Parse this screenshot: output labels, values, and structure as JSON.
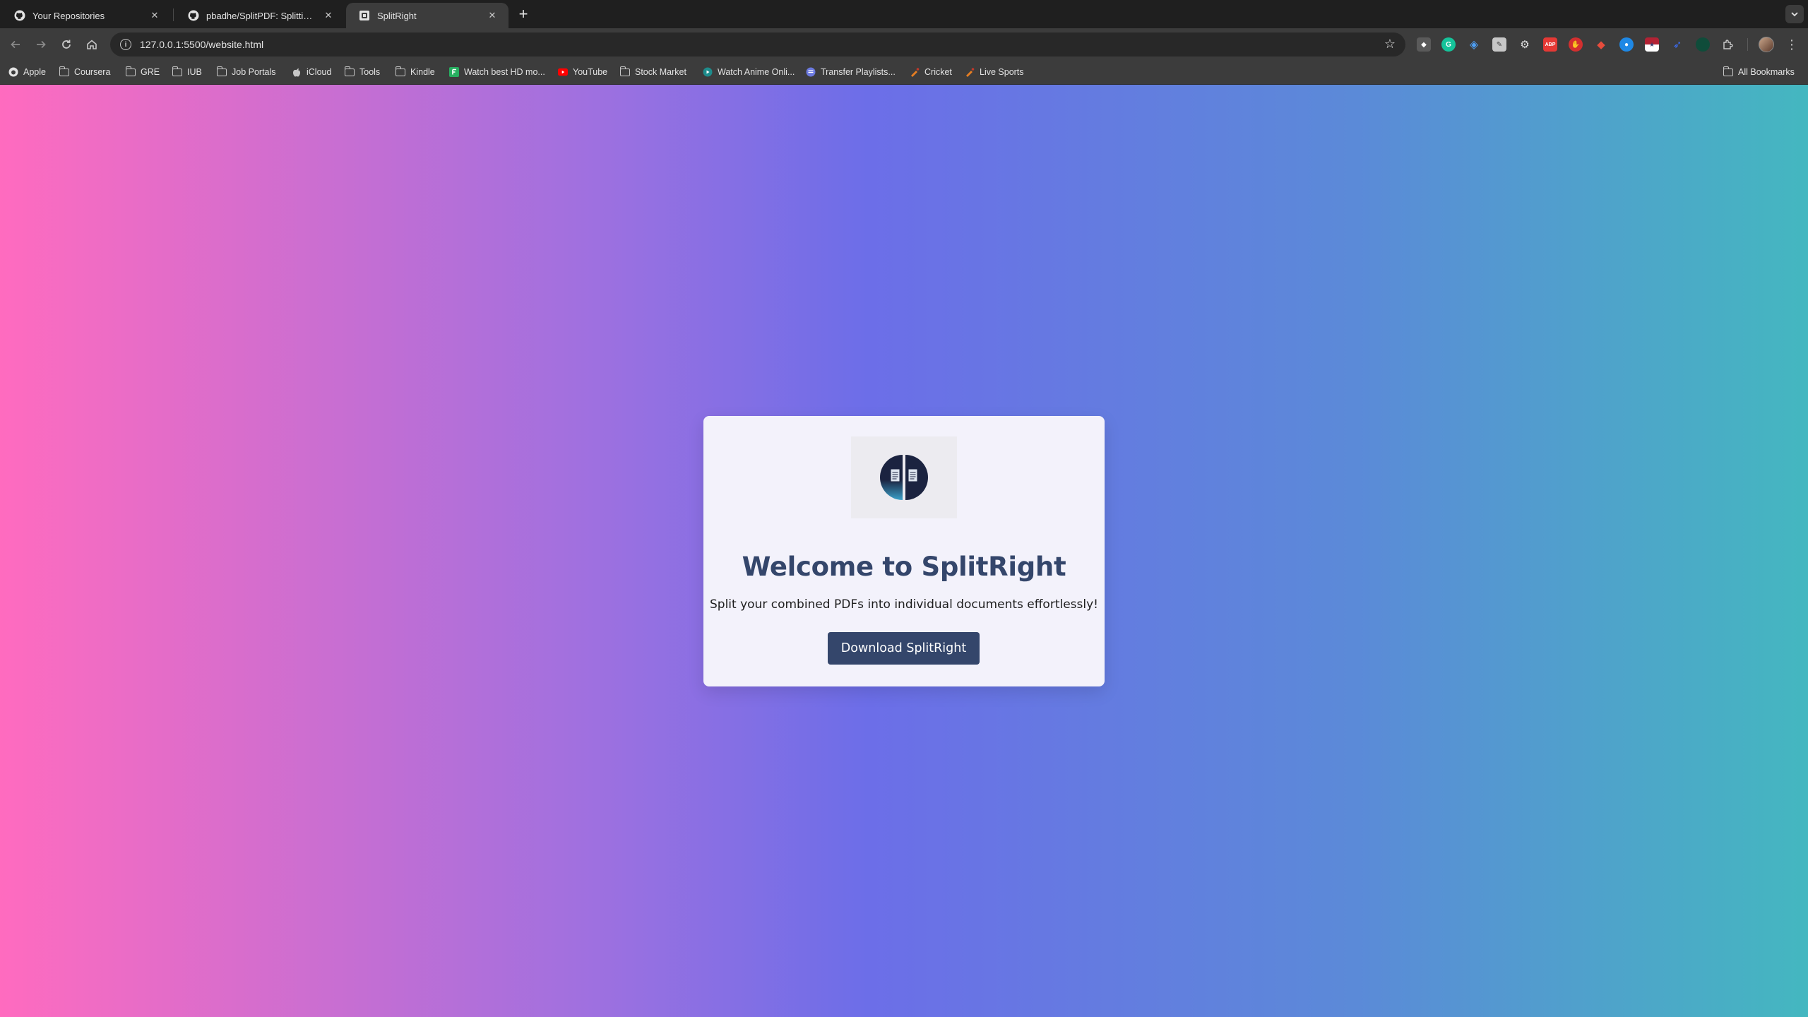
{
  "browser": {
    "tabs": [
      {
        "title": "Your Repositories",
        "favicon": "github-icon",
        "active": false
      },
      {
        "title": "pbadhe/SplitPDF: Splitting PDF",
        "favicon": "github-icon",
        "active": false
      },
      {
        "title": "SplitRight",
        "favicon": "page-icon",
        "active": true
      }
    ],
    "new_tab_label": "+",
    "address": "127.0.0.1:5500/website.html",
    "bookmarks": [
      {
        "label": "Apple",
        "icon": "apple-icon"
      },
      {
        "label": "Coursera",
        "icon": "folder-icon"
      },
      {
        "label": "GRE",
        "icon": "folder-icon"
      },
      {
        "label": "IUB",
        "icon": "folder-icon"
      },
      {
        "label": "Job Portals",
        "icon": "folder-icon"
      },
      {
        "label": "iCloud",
        "icon": "apple-icon"
      },
      {
        "label": "Tools",
        "icon": "folder-icon"
      },
      {
        "label": "Kindle",
        "icon": "folder-icon"
      },
      {
        "label": "Watch best HD mo...",
        "icon": "film-icon"
      },
      {
        "label": "YouTube",
        "icon": "youtube-icon"
      },
      {
        "label": "Stock Market",
        "icon": "folder-icon"
      },
      {
        "label": "Watch Anime Onli...",
        "icon": "anime-icon"
      },
      {
        "label": "Transfer Playlists...",
        "icon": "playlist-icon"
      },
      {
        "label": "Cricket",
        "icon": "cricket-icon"
      },
      {
        "label": "Live Sports",
        "icon": "sports-icon"
      }
    ],
    "all_bookmarks_label": "All Bookmarks"
  },
  "page": {
    "heading": "Welcome to SplitRight",
    "subtitle": "Split your combined PDFs into individual documents effortlessly!",
    "download_button": "Download SplitRight"
  },
  "colors": {
    "gradient_left": "#ff6bbf",
    "gradient_mid": "#6c6ee8",
    "gradient_right": "#44b7c0",
    "card_bg": "#f3f2fb",
    "accent": "#34466b"
  }
}
